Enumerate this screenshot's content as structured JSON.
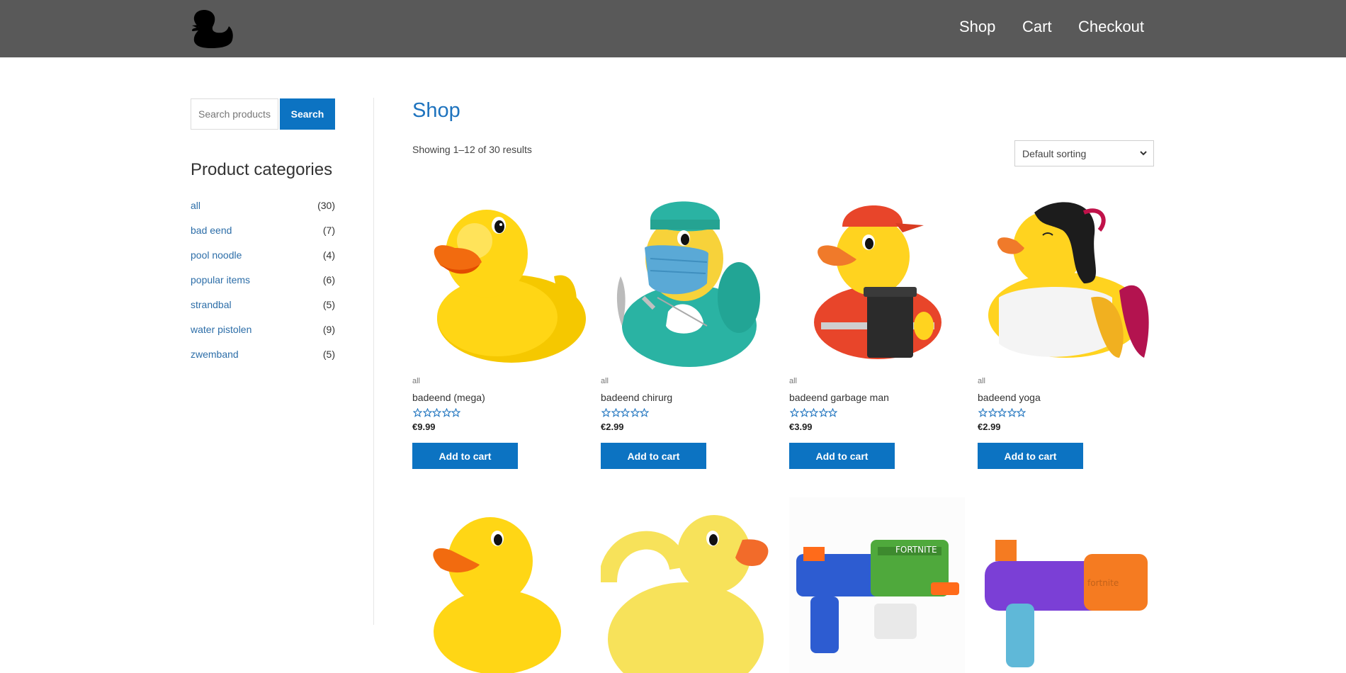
{
  "header": {
    "logo_icon": "rubber-duck-logo",
    "background": "#595959",
    "nav": [
      {
        "label": "Shop"
      },
      {
        "label": "Cart"
      },
      {
        "label": "Checkout"
      }
    ]
  },
  "sidebar": {
    "search": {
      "placeholder": "Search products…",
      "button_label": "Search"
    },
    "categories_title": "Product categories",
    "categories": [
      {
        "name": "all",
        "count": "(30)"
      },
      {
        "name": "bad eend",
        "count": "(7)"
      },
      {
        "name": "pool noodle",
        "count": "(4)"
      },
      {
        "name": "popular items",
        "count": "(6)"
      },
      {
        "name": "strandbal",
        "count": "(5)"
      },
      {
        "name": "water pistolen",
        "count": "(9)"
      },
      {
        "name": "zwemband",
        "count": "(5)"
      }
    ]
  },
  "main": {
    "title": "Shop",
    "result_count": "Showing 1–12 of 30 results",
    "sorting": {
      "selected": "Default sorting"
    },
    "products": [
      {
        "category": "all",
        "title": "badeend (mega)",
        "price": "€9.99",
        "button": "Add to cart",
        "image": "yellow-duck"
      },
      {
        "category": "all",
        "title": "badeend chirurg",
        "price": "€2.99",
        "button": "Add to cart",
        "image": "surgeon-duck"
      },
      {
        "category": "all",
        "title": "badeend garbage man",
        "price": "€3.99",
        "button": "Add to cart",
        "image": "garbage-man-duck"
      },
      {
        "category": "all",
        "title": "badeend yoga",
        "price": "€2.99",
        "button": "Add to cart",
        "image": "yoga-duck"
      },
      {
        "image": "yellow-duck-small"
      },
      {
        "image": "watering-can-duck"
      },
      {
        "image": "fortnite-water-blaster"
      },
      {
        "image": "purple-water-blaster"
      }
    ]
  },
  "colors": {
    "accent": "#0c73c2",
    "link": "#2d6ea8",
    "title": "#1e73be",
    "star": "#1e73be"
  }
}
